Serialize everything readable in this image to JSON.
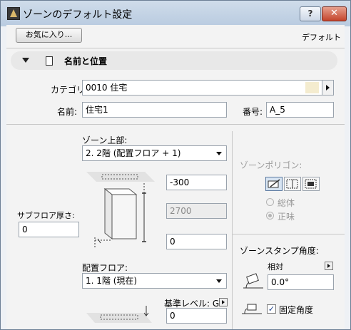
{
  "window": {
    "title": "ゾーンのデフォルト設定",
    "help_label": "?",
    "close_label": "✕"
  },
  "toolbar": {
    "favorites_label": "お気に入り...",
    "default_label": "デフォルト"
  },
  "section": {
    "title": "名前と位置"
  },
  "category": {
    "label": "カテゴリ:",
    "value": "0010  住宅",
    "swatch_color": "#f4eccf"
  },
  "name": {
    "label": "名前:",
    "value": "住宅1"
  },
  "number": {
    "label": "番号:",
    "value": "A_5"
  },
  "zone_top": {
    "label": "ゾーン上部:",
    "value": "2. 2階 (配置フロア + 1)",
    "offset": "-300",
    "height": "2700",
    "bottom_offset": "0"
  },
  "subfloor": {
    "label": "サブフロア厚さ:",
    "value": "0"
  },
  "home_story": {
    "label": "配置フロア:",
    "value": "1. 1階 (現在)"
  },
  "reference_level": {
    "label": "基準レベル: GL",
    "value": "0"
  },
  "zone_polygon": {
    "label": "ゾーンポリゴン:",
    "option_gross": "総体",
    "option_net": "正味",
    "selected": "net"
  },
  "stamp_angle": {
    "label": "ゾーンスタンプ角度:",
    "mode_label": "相対",
    "value": "0.0°",
    "fixed_label": "固定角度",
    "fixed_checked": true
  }
}
